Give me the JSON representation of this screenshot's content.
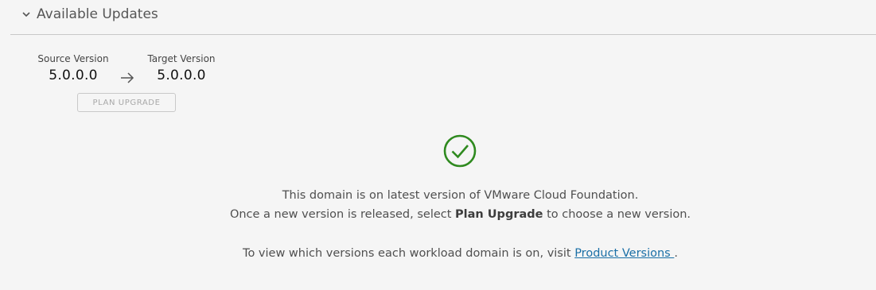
{
  "section": {
    "title": "Available Updates",
    "expanded_icon": "chevron-down-icon"
  },
  "versions": {
    "source_label": "Source Version",
    "source_value": "5.0.0.0",
    "target_label": "Target Version",
    "target_value": "5.0.0.0",
    "arrow_icon": "arrow-right-icon"
  },
  "plan_button": {
    "label": "PLAN UPGRADE",
    "disabled": true
  },
  "status": {
    "icon": "check-circle-icon",
    "icon_color": "#2f8a1f",
    "line1": "This domain is on latest version of VMware Cloud Foundation.",
    "line2_prefix": "Once a new version is released, select ",
    "line2_bold": "Plan Upgrade",
    "line2_suffix": " to choose a new version.",
    "line3_prefix": "To view which versions each workload domain is on, visit ",
    "line3_link": "Product Versions ",
    "line3_suffix": "."
  },
  "colors": {
    "background": "#f5f5f5",
    "link": "#1a6fa6",
    "success": "#2f8a1f"
  }
}
